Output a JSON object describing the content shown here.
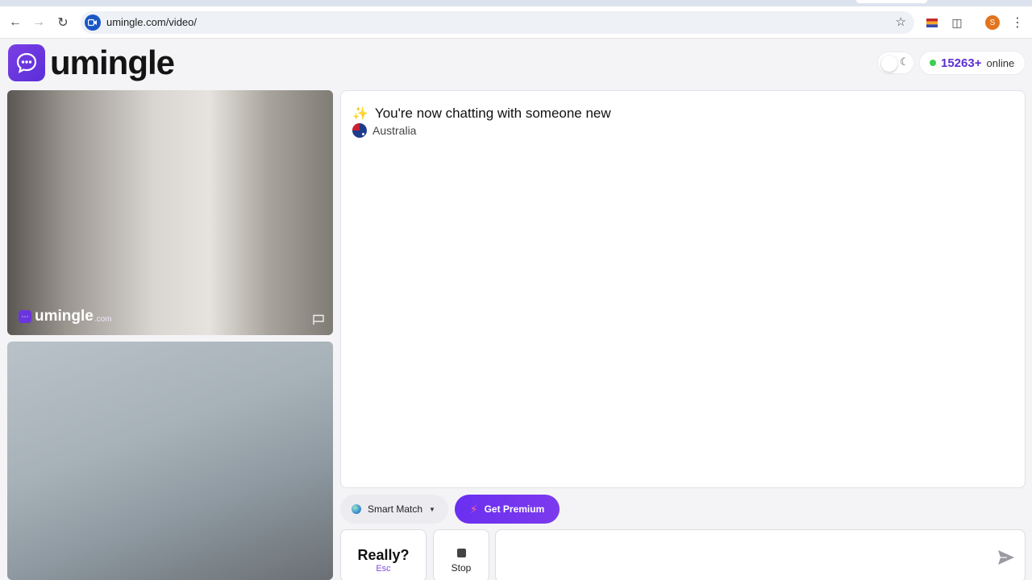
{
  "browser": {
    "url": "umingle.com/video/",
    "profile_initial": "S"
  },
  "header": {
    "logo_text": "umingle",
    "online_count": "15263+",
    "online_label": "online"
  },
  "video": {
    "watermark_text": "umingle",
    "watermark_suffix": ".com"
  },
  "chat": {
    "headline": "You're now chatting with someone new",
    "country": "Australia"
  },
  "controls": {
    "smart_match_label": "Smart Match",
    "premium_label": "Get Premium",
    "really_label": "Really?",
    "esc_label": "Esc",
    "stop_label": "Stop",
    "message_placeholder": ""
  },
  "colors": {
    "brand_purple": "#6a2ff0",
    "online_green": "#3ccf4e"
  }
}
